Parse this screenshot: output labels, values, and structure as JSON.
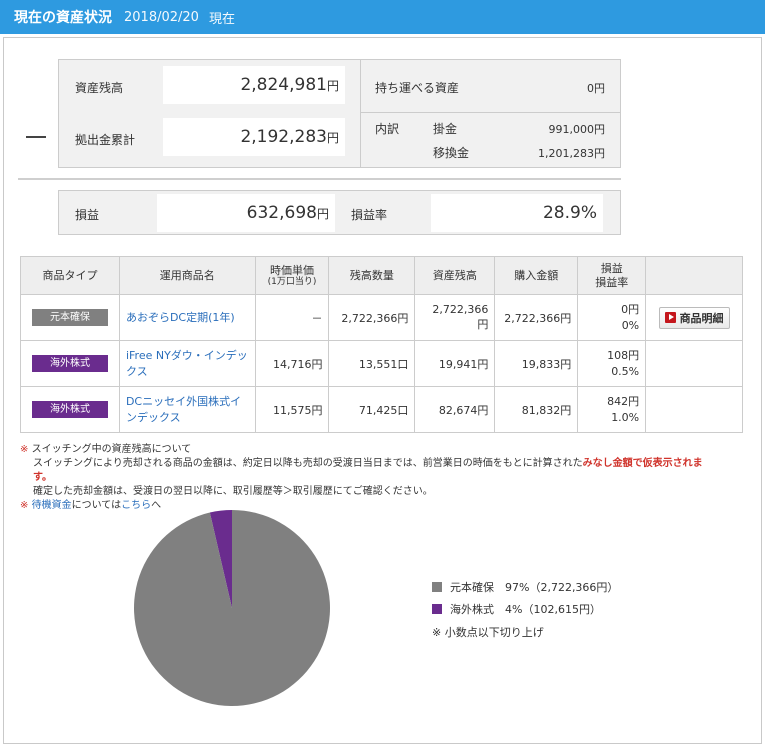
{
  "header": {
    "title": "現在の資産状況",
    "date": "2018/02/20",
    "date_suffix": "現在"
  },
  "summary": {
    "balance_label": "資産残高",
    "balance_value": "2,824,981",
    "balance_unit": "円",
    "contrib_label": "拠出金累計",
    "contrib_value": "2,192,283",
    "contrib_unit": "円",
    "portable_label": "持ち運べる資産",
    "portable_value": "0円",
    "breakdown_label": "内訳",
    "kakekin_label": "掛金",
    "kakekin_value": "991,000円",
    "transfer_label": "移換金",
    "transfer_value": "1,201,283円"
  },
  "pl": {
    "label": "損益",
    "value": "632,698",
    "unit": "円",
    "rate_label": "損益率",
    "rate_value": "28.9%"
  },
  "table": {
    "headers": {
      "type": "商品タイプ",
      "name": "運用商品名",
      "price": "時価単価",
      "price_sub": "(1万口当り)",
      "qty": "残高数量",
      "balance": "資産残高",
      "purchase": "購入金額",
      "pl": "損益",
      "pl_rate": "損益率"
    },
    "rows": [
      {
        "type": "元本確保",
        "name_line1": "あおぞらDC定期(1年)",
        "name_line2": "",
        "price": "－",
        "qty": "2,722,366円",
        "balance": "2,722,366円",
        "purchase": "2,722,366円",
        "pl": "0円",
        "pl_rate": "0%",
        "detail": "商品明細"
      },
      {
        "type": "海外株式",
        "name_line1": "iFree NYダウ・インデッ",
        "name_line2": "クス",
        "price": "14,716円",
        "qty": "13,551口",
        "balance": "19,941円",
        "purchase": "19,833円",
        "pl": "108円",
        "pl_rate": "0.5%"
      },
      {
        "type": "海外株式",
        "name_line1": "DCニッセイ外国株式イ",
        "name_line2": "ンデックス",
        "price": "11,575円",
        "qty": "71,425口",
        "balance": "82,674円",
        "purchase": "81,832円",
        "pl": "842円",
        "pl_rate": "1.0%"
      }
    ]
  },
  "notes": {
    "mark": "※",
    "line1": "スイッチング中の資産残高について",
    "line2a": "スイッチングにより売却される商品の金額は、約定日以降も売却の受渡日当日までは、前営業日の時価をもとに計算された",
    "line2b": "みなし金額で仮表示されます。",
    "line3": "確定した売却金額は、受渡日の翌日以降に、取引履歴等＞取引履歴にてご確認ください。",
    "line4a": "待機資金",
    "line4b": "については",
    "line4c": "こちら",
    "line4d": "へ"
  },
  "legend": {
    "item1": "元本確保　97%（2,722,366円）",
    "item2": "海外株式　4%（102,615円）",
    "footnote": "※ 小数点以下切り上げ"
  },
  "colors": {
    "header": "#2e9ae0",
    "gray": "#808080",
    "purple": "#6a2c8e",
    "link": "#2a6ebb",
    "alert": "#d0342c"
  },
  "chart_data": {
    "type": "pie",
    "categories": [
      "元本確保",
      "海外株式"
    ],
    "values": [
      2722366,
      102615
    ],
    "percent_labels": [
      "97%",
      "4%"
    ],
    "colors": [
      "#808080",
      "#6a2c8e"
    ]
  }
}
